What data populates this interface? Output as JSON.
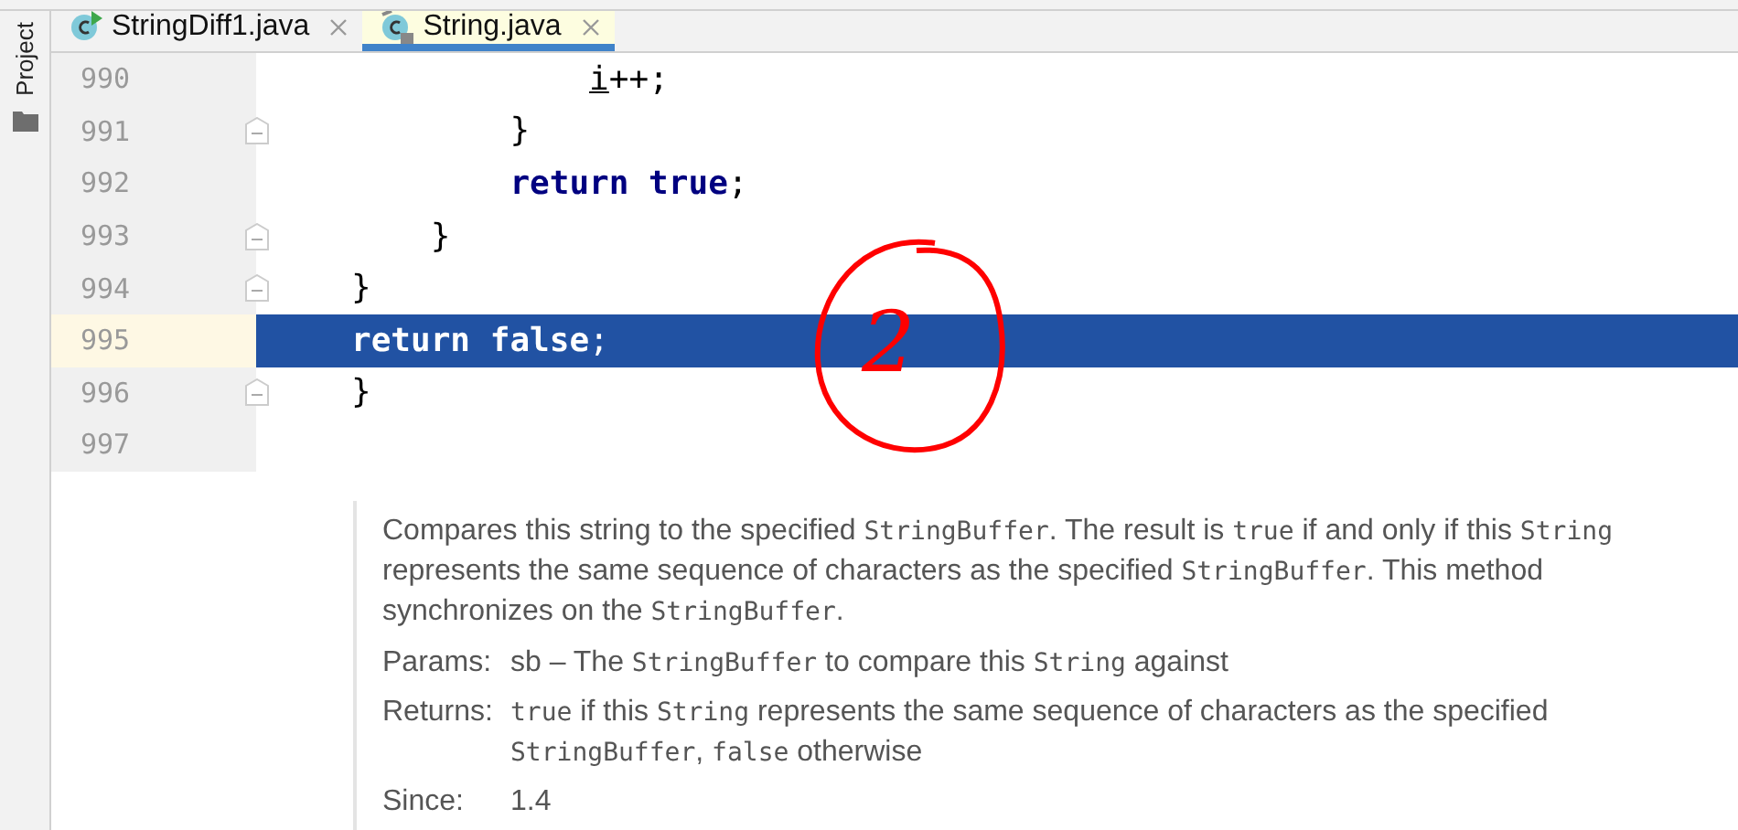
{
  "side_panel": {
    "label": "Project"
  },
  "tabs": [
    {
      "label": "StringDiff1.java",
      "selected": false
    },
    {
      "label": "String.java",
      "selected": true
    }
  ],
  "lines": [
    {
      "number": "990",
      "fold": false,
      "selected": false,
      "tokens": [
        {
          "text": "            i",
          "kind": "reassigned"
        },
        {
          "text": "++;"
        }
      ]
    },
    {
      "number": "991",
      "fold": true,
      "selected": false,
      "tokens": [
        {
          "text": "        }"
        }
      ]
    },
    {
      "number": "992",
      "fold": false,
      "selected": false,
      "tokens": [
        {
          "text": "        return true",
          "kind": "keyword"
        },
        {
          "text": ";"
        }
      ]
    },
    {
      "number": "993",
      "fold": true,
      "selected": false,
      "tokens": [
        {
          "text": "    }"
        }
      ]
    },
    {
      "number": "994",
      "fold": true,
      "selected": false,
      "tokens": [
        {
          "text": "}"
        }
      ]
    },
    {
      "number": "995",
      "fold": false,
      "selected": true,
      "tokens": [
        {
          "text": "return false",
          "kind": "keyword"
        },
        {
          "text": ";"
        }
      ]
    },
    {
      "number": "996",
      "fold": true,
      "selected": false,
      "tokens": [
        {
          "text": "}"
        }
      ]
    },
    {
      "number": "997",
      "fold": false,
      "selected": false
    }
  ],
  "doc": {
    "description": [
      {
        "text": "Compares this string to the specified "
      },
      {
        "text": "StringBuffer",
        "kind": "code"
      },
      {
        "text": ". The result is "
      },
      {
        "text": "true",
        "kind": "code"
      },
      {
        "text": " if and only if this "
      },
      {
        "text": "String",
        "kind": "code"
      },
      {
        "text": " represents the same sequence of characters as the specified "
      },
      {
        "text": "StringBuffer",
        "kind": "code"
      },
      {
        "text": ". This method synchronizes on the "
      },
      {
        "text": "StringBuffer",
        "kind": "code"
      },
      {
        "text": "."
      }
    ],
    "sections": [
      {
        "label": "Params:",
        "value": [
          {
            "text": "sb – The "
          },
          {
            "text": "StringBuffer",
            "kind": "code"
          },
          {
            "text": " to compare this "
          },
          {
            "text": "String",
            "kind": "code"
          },
          {
            "text": " against"
          }
        ]
      },
      {
        "label": "Returns:",
        "value": [
          {
            "text": "true",
            "kind": "code"
          },
          {
            "text": " if this "
          },
          {
            "text": "String",
            "kind": "code"
          },
          {
            "text": " represents the same sequence of characters as the specified "
          },
          {
            "text": "StringBuffer",
            "kind": "code"
          },
          {
            "text": ", "
          },
          {
            "text": "false",
            "kind": "code"
          },
          {
            "text": " otherwise"
          }
        ]
      },
      {
        "label": "Since:",
        "value": [
          {
            "text": "1.4"
          }
        ]
      }
    ]
  },
  "annotation": {
    "text": "2"
  }
}
